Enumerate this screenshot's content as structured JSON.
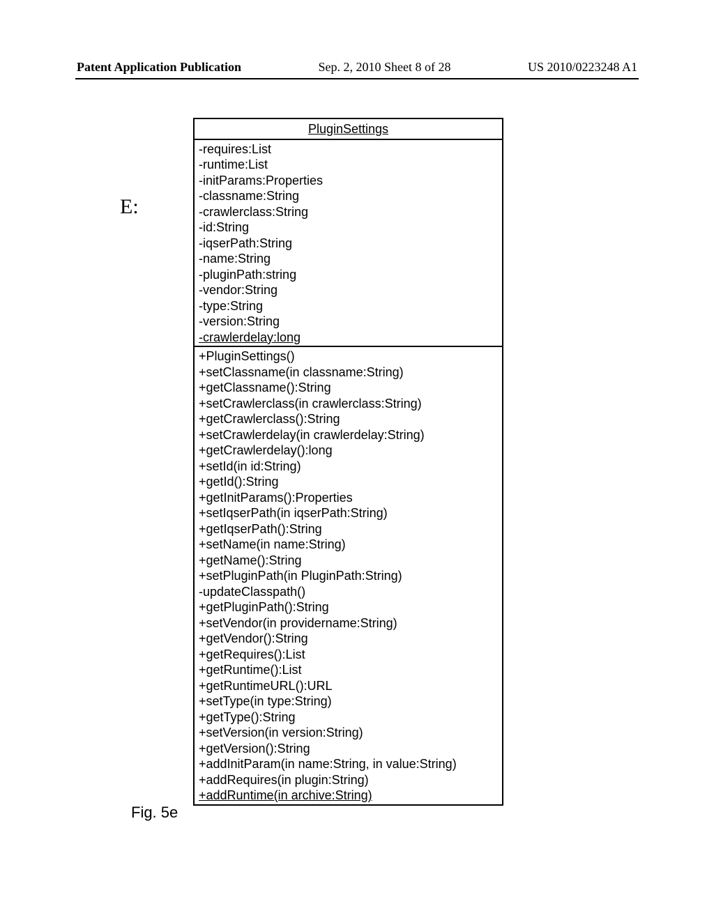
{
  "header": {
    "left": "Patent Application Publication",
    "center": "Sep. 2, 2010  Sheet 8 of 28",
    "right": "US 2010/0223248 A1"
  },
  "labels": {
    "e": "E:",
    "fig": "Fig. 5e"
  },
  "uml": {
    "name": "PluginSettings",
    "attributes": [
      "-requires:List",
      "-runtime:List",
      "-initParams:Properties",
      "-classname:String",
      "-crawlerclass:String",
      "-id:String",
      "-iqserPath:String",
      "-name:String",
      "-pluginPath:string",
      "-vendor:String",
      "-type:String",
      "-version:String",
      "-crawlerdelay:long"
    ],
    "operations": [
      "+PluginSettings()",
      "+setClassname(in classname:String)",
      "+getClassname():String",
      "+setCrawlerclass(in crawlerclass:String)",
      "+getCrawlerclass():String",
      "+setCrawlerdelay(in crawlerdelay:String)",
      "+getCrawlerdelay():long",
      "+setId(in id:String)",
      "+getId():String",
      "+getInitParams():Properties",
      "+setIqserPath(in iqserPath:String)",
      "+getIqserPath():String",
      "+setName(in name:String)",
      "+getName():String",
      "+setPluginPath(in PluginPath:String)",
      "-updateClasspath()",
      "+getPluginPath():String",
      "+setVendor(in providername:String)",
      "+getVendor():String",
      "+getRequires():List",
      "+getRuntime():List",
      "+getRuntimeURL():URL",
      "+setType(in type:String)",
      "+getType():String",
      "+setVersion(in version:String)",
      "+getVersion():String",
      "+addInitParam(in name:String, in value:String)",
      "+addRequires(in plugin:String)",
      "+addRuntime(in archive:String)"
    ]
  }
}
